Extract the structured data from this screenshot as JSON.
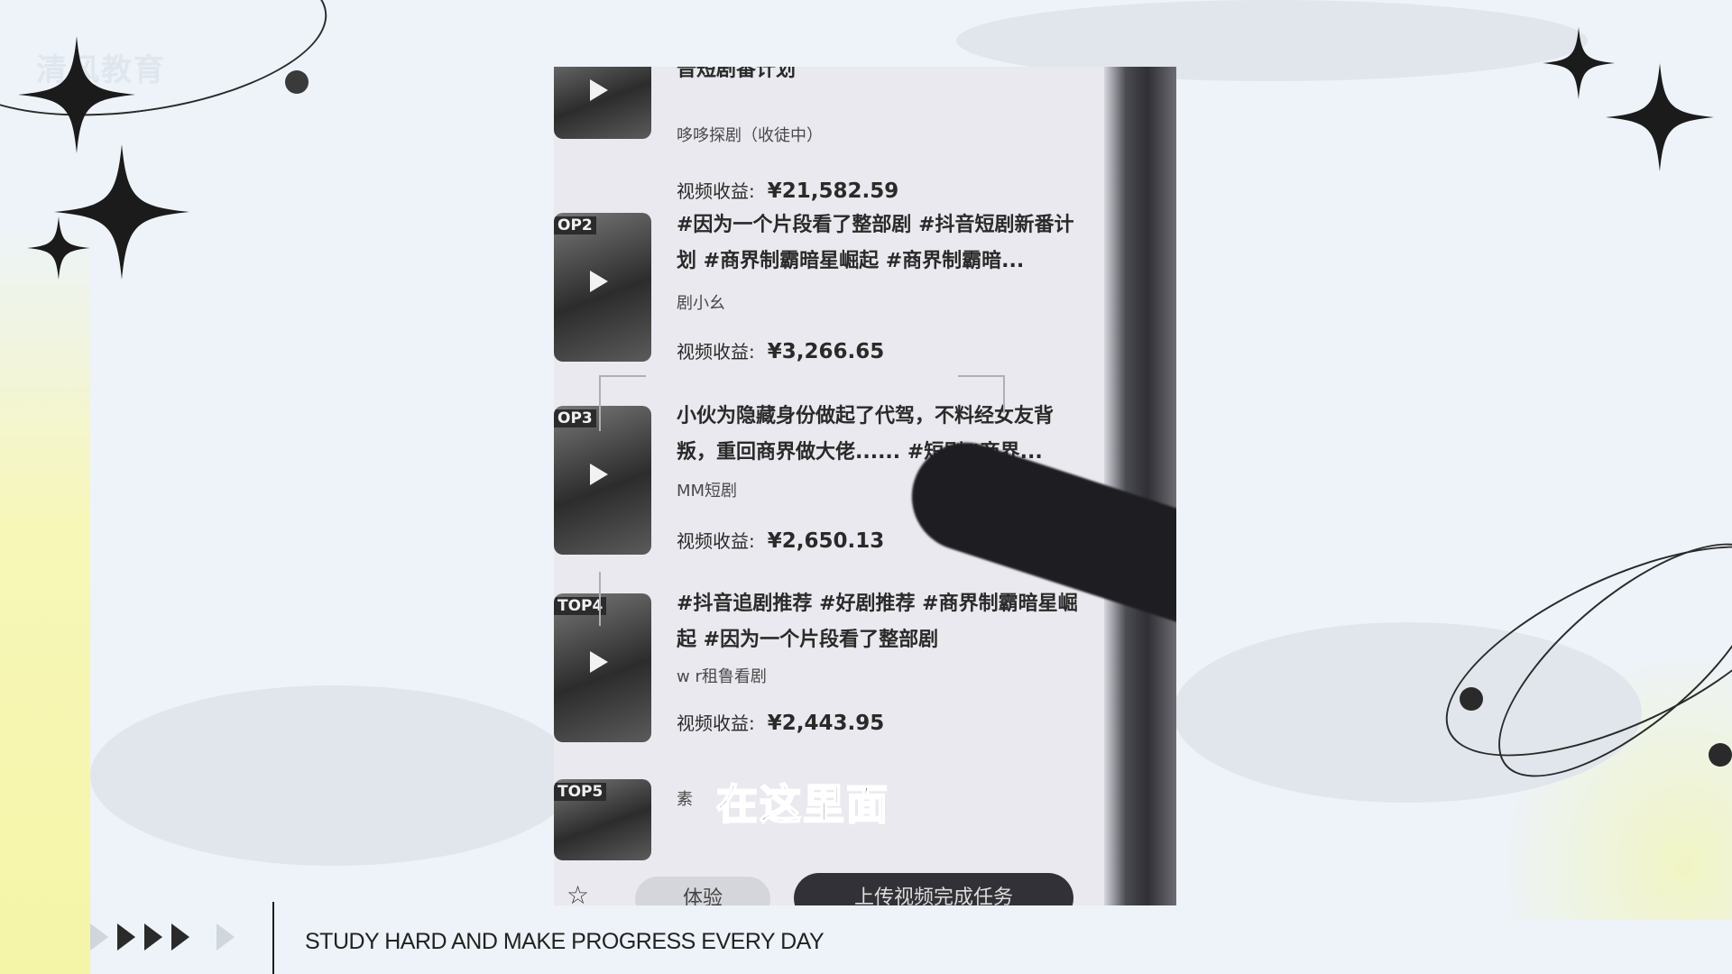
{
  "header": {
    "logo_text": "清风教育"
  },
  "footer": {
    "slogan": "STUDY HARD AND MAKE PROGRESS EVERY DAY"
  },
  "video_list": {
    "earnings_label": "视频收益:",
    "items": [
      {
        "title": "普短剧番计划",
        "author": "哆哆探剧（收徒中）",
        "earnings": "¥21,582.59",
        "rank": ""
      },
      {
        "title": "#因为一个片段看了整部剧 #抖音短剧新番计划 #商界制霸暗星崛起 #商界制霸暗...",
        "author": "剧小幺",
        "earnings": "¥3,266.65",
        "rank": "OP2"
      },
      {
        "title": "小伙为隐藏身份做起了代驾，不料经女友背叛，重回商界做大佬...... #短剧#商界...",
        "author": "MM短剧",
        "earnings": "¥2,650.13",
        "rank": "OP3"
      },
      {
        "title": "#抖音追剧推荐 #好剧推荐 #商界制霸暗星崛起 #因为一个片段看了整部剧",
        "author": "w r租鲁看剧",
        "earnings": "¥2,443.95",
        "rank": "TOP4"
      },
      {
        "title": "",
        "author": "素",
        "earnings": "",
        "rank": "TOP5"
      }
    ]
  },
  "subtitle": "在这里面",
  "bottom_actions": {
    "experience": "体验",
    "upload": "上传视频完成任务"
  },
  "icons": [
    "star-icon",
    "play-icon",
    "sparkle-icon"
  ]
}
